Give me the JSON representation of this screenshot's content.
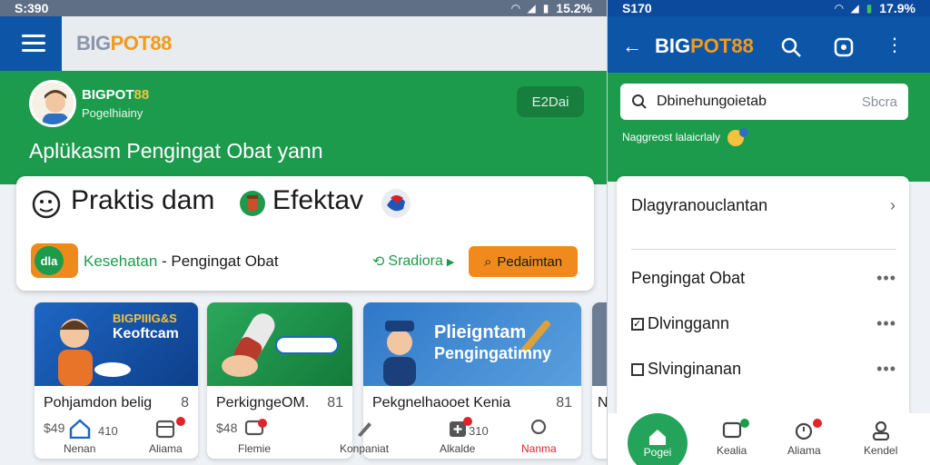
{
  "left": {
    "status": {
      "time": "S:390",
      "battery": "15.2%"
    },
    "logo": {
      "big": "BIG",
      "pot": "POT88"
    },
    "brand": {
      "name_big": "BIGPOT",
      "name_pot": "88",
      "subtitle": "Pogelhiainy"
    },
    "chip_button": "E2Dai",
    "headline": "Aplükasm Pengingat Obat yann",
    "card": {
      "title_part1": "Praktis dam",
      "title_part2": "Efektav",
      "badge": "dla",
      "category_green": "Kesehatan",
      "category_rest": " - Pengingat Obat",
      "link": "Sradiora",
      "cta": "Pedaimtan"
    },
    "tiles": [
      {
        "img_line1": "BIGPIIIG&S",
        "img_line2": "Keoftcam",
        "title": "Pohjamdon belig",
        "num": "8",
        "price": "$49"
      },
      {
        "img_line1": "",
        "img_line2": "",
        "title": "PerkigngeOM.",
        "num": "81",
        "price": "$48"
      },
      {
        "img_line1": "Plieigntam",
        "img_line2": "Pengingatimny",
        "title": "Pekgnelhaooet Kenia",
        "num": "81",
        "price": ""
      }
    ],
    "nav": [
      {
        "label": "Nenan",
        "icon": "home-icon",
        "extra": "410"
      },
      {
        "label": "Aliama",
        "icon": "calendar-icon"
      },
      {
        "label": "Flemie",
        "icon": "chat-icon"
      },
      {
        "label": "Konpaniat",
        "icon": "pen-icon"
      },
      {
        "label": "Alkalde",
        "icon": "add-box-icon",
        "extra": "310"
      },
      {
        "label": "Nanma",
        "icon": "profile-icon"
      }
    ],
    "clipped_tile_letter": "N"
  },
  "right": {
    "status": {
      "time": "S170",
      "battery": "17.9%"
    },
    "logo": {
      "big": "BIG",
      "pot": "POT88"
    },
    "search": {
      "value": "Dbinehungoietab",
      "action": "Sbcra"
    },
    "promo": "Naggreost lalaicrlaly",
    "section_title": "Dlagyranouclantan",
    "rows": [
      {
        "label": "Pengingat Obat"
      },
      {
        "label": "Dlvinggann"
      },
      {
        "label": "Slvinginanan"
      }
    ],
    "nav": [
      {
        "label": "Pogei",
        "icon": "home-icon"
      },
      {
        "label": "Kealia",
        "icon": "chat-icon"
      },
      {
        "label": "Aliama",
        "icon": "alarm-icon"
      },
      {
        "label": "Kendel",
        "icon": "profile-icon"
      }
    ]
  },
  "colors": {
    "primary_blue": "#0d55a6",
    "green": "#1d9b4c",
    "orange": "#f08a1d",
    "red": "#e0242a"
  }
}
